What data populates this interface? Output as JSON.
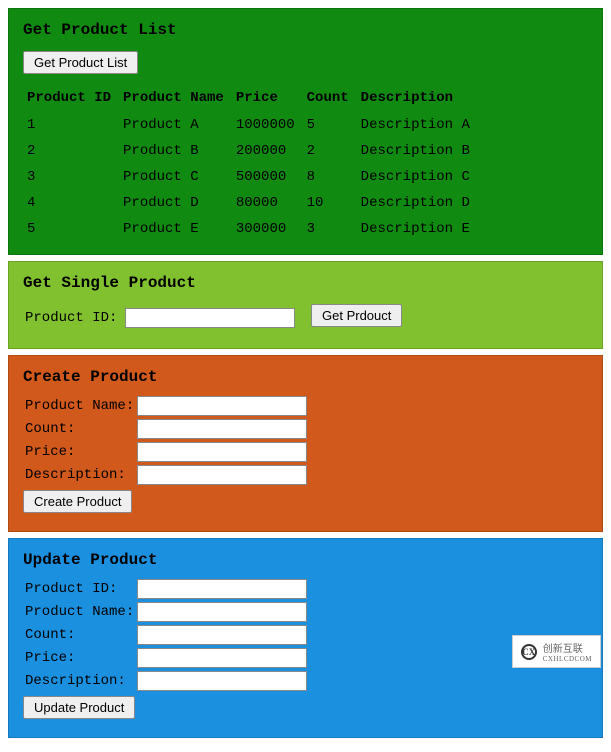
{
  "listPanel": {
    "title": "Get Product List",
    "buttonLabel": "Get Product List",
    "columns": [
      "Product ID",
      "Product Name",
      "Price",
      "Count",
      "Description"
    ],
    "rows": [
      {
        "id": "1",
        "name": "Product A",
        "price": "1000000",
        "count": "5",
        "desc": "Description A"
      },
      {
        "id": "2",
        "name": "Product B",
        "price": "200000",
        "count": "2",
        "desc": "Description B"
      },
      {
        "id": "3",
        "name": "Product C",
        "price": "500000",
        "count": "8",
        "desc": "Description C"
      },
      {
        "id": "4",
        "name": "Product D",
        "price": "80000",
        "count": "10",
        "desc": "Description D"
      },
      {
        "id": "5",
        "name": "Product E",
        "price": "300000",
        "count": "3",
        "desc": "Description E"
      }
    ]
  },
  "singlePanel": {
    "title": "Get Single Product",
    "label": "Product ID:",
    "value": "",
    "buttonLabel": "Get Prdouct"
  },
  "createPanel": {
    "title": "Create Product",
    "fields": {
      "name": {
        "label": "Product Name:",
        "value": ""
      },
      "count": {
        "label": "Count:",
        "value": ""
      },
      "price": {
        "label": "Price:",
        "value": ""
      },
      "desc": {
        "label": "Description:",
        "value": ""
      }
    },
    "buttonLabel": "Create Product"
  },
  "updatePanel": {
    "title": "Update Product",
    "fields": {
      "id": {
        "label": "Product ID:",
        "value": ""
      },
      "name": {
        "label": "Product Name:",
        "value": ""
      },
      "count": {
        "label": "Count:",
        "value": ""
      },
      "price": {
        "label": "Price:",
        "value": ""
      },
      "desc": {
        "label": "Description:",
        "value": ""
      }
    },
    "buttonLabel": "Update Product"
  },
  "watermark": {
    "brand": "创新互联",
    "sub": "CXHLCDCOM",
    "logoText": "CX"
  }
}
